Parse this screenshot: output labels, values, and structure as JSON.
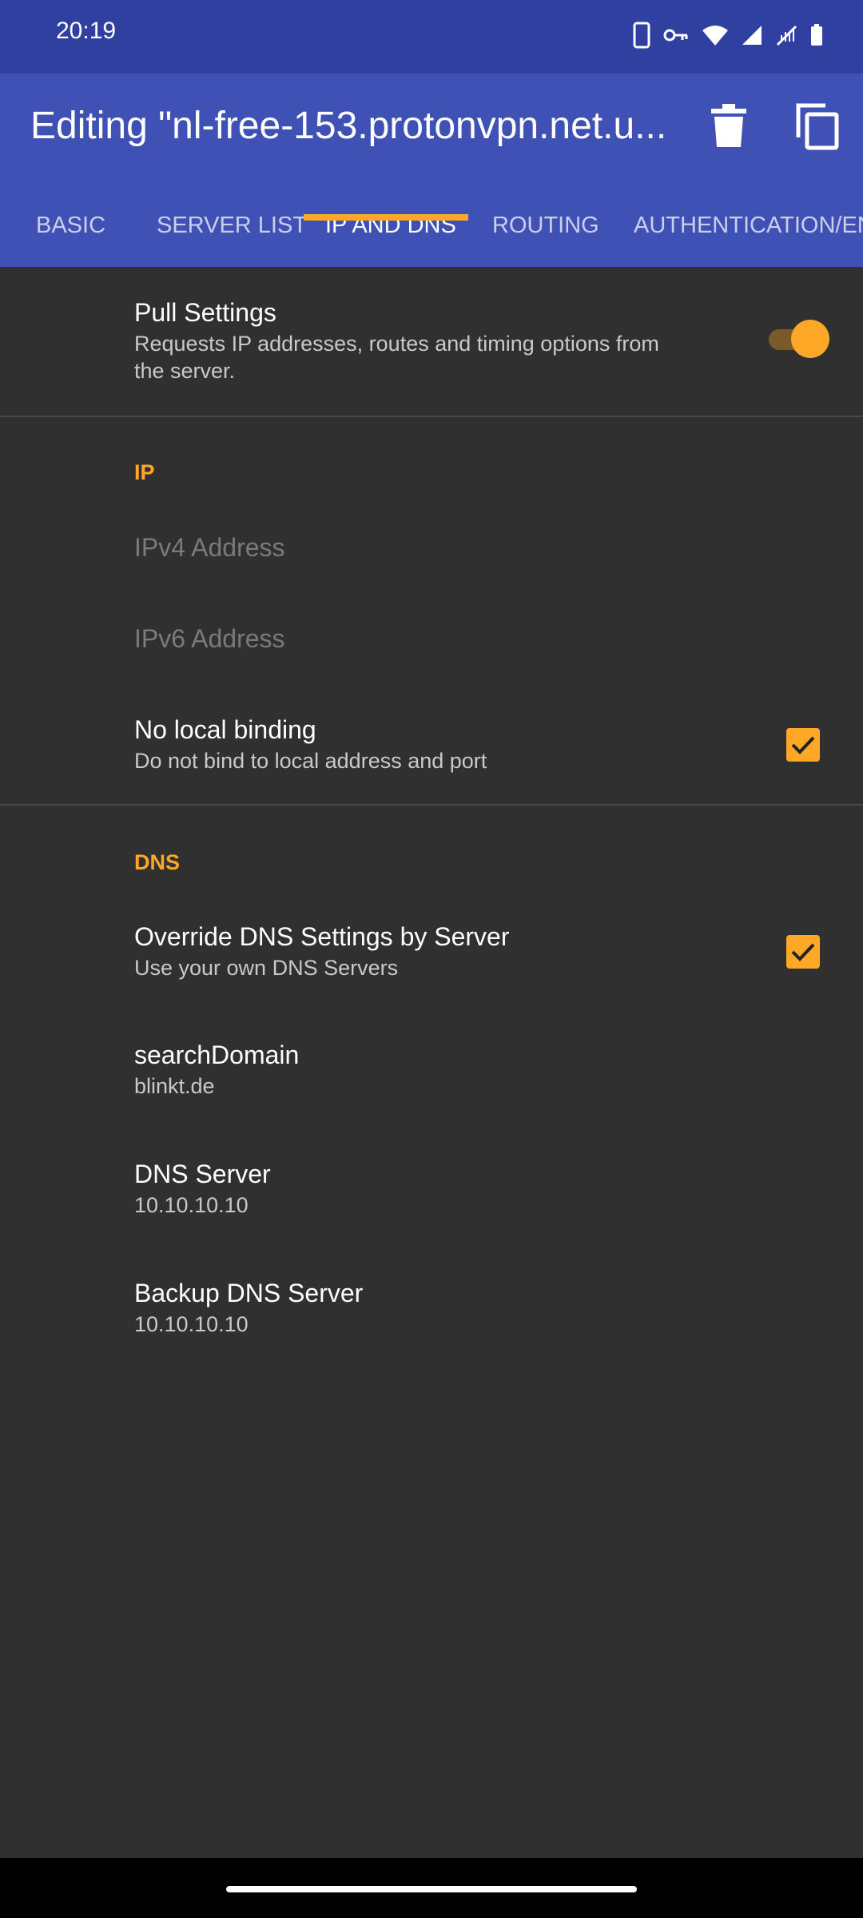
{
  "status_bar": {
    "time": "20:19",
    "icons": [
      "phone-icon",
      "vpn-key-icon",
      "wifi-icon",
      "cellular-signal-icon",
      "no-data-icon",
      "battery-icon"
    ]
  },
  "app_bar": {
    "title": "Editing \"nl-free-153.protonvpn.net.u...",
    "delete_icon": "trash-icon",
    "copy_icon": "copy-icon"
  },
  "tabs": [
    {
      "label": "BASIC"
    },
    {
      "label": "SERVER LIST"
    },
    {
      "label": "IP AND DNS",
      "active": true
    },
    {
      "label": "ROUTING"
    },
    {
      "label": "AUTHENTICATION/ENC"
    }
  ],
  "pull_settings": {
    "title": "Pull Settings",
    "summary_line1": "Requests IP addresses, routes and timing options from",
    "summary_line2": "the server.",
    "enabled": true
  },
  "ip_section": {
    "header": "IP",
    "ipv4_placeholder": "IPv4 Address",
    "ipv6_placeholder": "IPv6 Address",
    "no_local_binding": {
      "title": "No local binding",
      "summary": "Do not bind to local address and port",
      "checked": true
    }
  },
  "dns_section": {
    "header": "DNS",
    "override": {
      "title": "Override DNS Settings by Server",
      "summary": "Use your own DNS Servers",
      "checked": true
    },
    "search_domain": {
      "title": "searchDomain",
      "value": "blinkt.de"
    },
    "dns_server": {
      "title": "DNS Server",
      "value": "10.10.10.10"
    },
    "backup_dns_server": {
      "title": "Backup DNS Server",
      "value": "10.10.10.10"
    }
  },
  "colors": {
    "primary": "#3f51b5",
    "primary_dark": "#3040a0",
    "accent": "#ffa726",
    "background": "#303030"
  }
}
